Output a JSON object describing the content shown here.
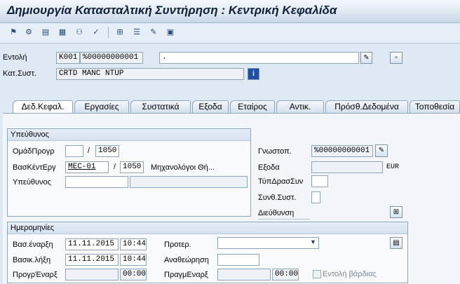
{
  "window": {
    "title": "Δημιουργία Κατασταλτική Συντήρηση : Κεντρική Κεφαλίδα"
  },
  "toolbar": {
    "icons": [
      "flag-icon",
      "settings-icon",
      "structure-icon",
      "calculator-icon",
      "partners-icon",
      "check-icon",
      "hierarchy-icon",
      "document-icon",
      "edit-icon",
      "clipboard-icon"
    ]
  },
  "header": {
    "order_label": "Εντολή",
    "order_type": "K001",
    "order_number": "%00000000001",
    "order_text": ".",
    "system_status_label": "Κατ.Συστ.",
    "system_status": "CRTD MANC NTUP"
  },
  "tabs": [
    {
      "label": "Δεδ.Κεφαλ.",
      "active": true
    },
    {
      "label": "Εργασίες",
      "active": false
    },
    {
      "label": "Συστατικά",
      "active": false
    },
    {
      "label": "Εξοδα",
      "active": false
    },
    {
      "label": "Εταίρος",
      "active": false
    },
    {
      "label": "Αντικ.",
      "active": false
    },
    {
      "label": "Πρόσθ.Δεδομένα",
      "active": false
    },
    {
      "label": "Τοποθεσία",
      "active": false
    }
  ],
  "responsible": {
    "group_title": "Υπεύθυνος",
    "planner_group_label": "ΟμάδΠρογρ",
    "planner_group_value": "",
    "planner_plant": "1050",
    "main_workcenter_label": "ΒασΚέντΕργ",
    "main_workcenter_value": "MEC-01",
    "main_workcenter_plant": "1050",
    "main_workcenter_desc": "Μηχανολόγοι Θή...",
    "responsible_label": "Υπεύθυνος",
    "responsible_value": "",
    "responsible_name": "",
    "slash": "/"
  },
  "right": {
    "notification_label": "Γνωστοπ.",
    "notification_value": "%00000000001",
    "costs_label": "Εξοδα",
    "costs_value": "",
    "currency": "EUR",
    "activity_type_label": "ΤύπΔρασΣυν",
    "activity_type_value": "",
    "sys_condition_label": "Συνθ.Συστ.",
    "sys_condition_value": "",
    "address_label": "Διεύθυνση"
  },
  "dates": {
    "group_title": "Ημερομηνίες",
    "basic_start_label": "Βασ.έναρξη",
    "basic_start_date": "11.11.2015",
    "basic_start_time": "10:44",
    "basic_finish_label": "Βασικ.λήξη",
    "basic_finish_date": "11.11.2015",
    "basic_finish_time": "10:44",
    "sched_start_label": "ΠρογρΈναρξ",
    "sched_start_date": "",
    "sched_start_time": "00:00",
    "priority_label": "Προτερ.",
    "priority_value": "",
    "revision_label": "Αναθεώρηση",
    "revision_value": "",
    "actual_start_label": "ΠραγμΕναρξ",
    "actual_start_date": "",
    "actual_start_time": "00:00",
    "reference_checkbox_label": "Εντολή βάρδιας"
  }
}
